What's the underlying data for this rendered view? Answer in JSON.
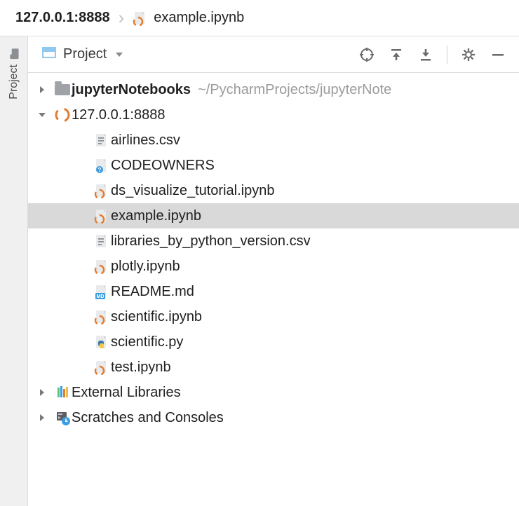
{
  "breadcrumb": {
    "root": "127.0.0.1:8888",
    "file": "example.ipynb"
  },
  "sidebar_tab": {
    "label": "Project"
  },
  "panel": {
    "title": "Project"
  },
  "tree": {
    "root": {
      "label": "jupyterNotebooks",
      "hint": "~/PycharmProjects/jupyterNote",
      "expanded": false
    },
    "server": {
      "label": "127.0.0.1:8888",
      "expanded": true,
      "files": [
        {
          "name": "airlines.csv",
          "icon": "text",
          "selected": false
        },
        {
          "name": "CODEOWNERS",
          "icon": "unknown",
          "selected": false
        },
        {
          "name": "ds_visualize_tutorial.ipynb",
          "icon": "ipynb",
          "selected": false
        },
        {
          "name": "example.ipynb",
          "icon": "ipynb",
          "selected": true
        },
        {
          "name": "libraries_by_python_version.csv",
          "icon": "text",
          "selected": false
        },
        {
          "name": "plotly.ipynb",
          "icon": "ipynb",
          "selected": false
        },
        {
          "name": "README.md",
          "icon": "md",
          "selected": false
        },
        {
          "name": "scientific.ipynb",
          "icon": "ipynb",
          "selected": false
        },
        {
          "name": "scientific.py",
          "icon": "py",
          "selected": false
        },
        {
          "name": "test.ipynb",
          "icon": "ipynb",
          "selected": false
        }
      ]
    },
    "ext_libs": {
      "label": "External Libraries",
      "expanded": false
    },
    "scratches": {
      "label": "Scratches and Consoles",
      "expanded": false
    }
  }
}
